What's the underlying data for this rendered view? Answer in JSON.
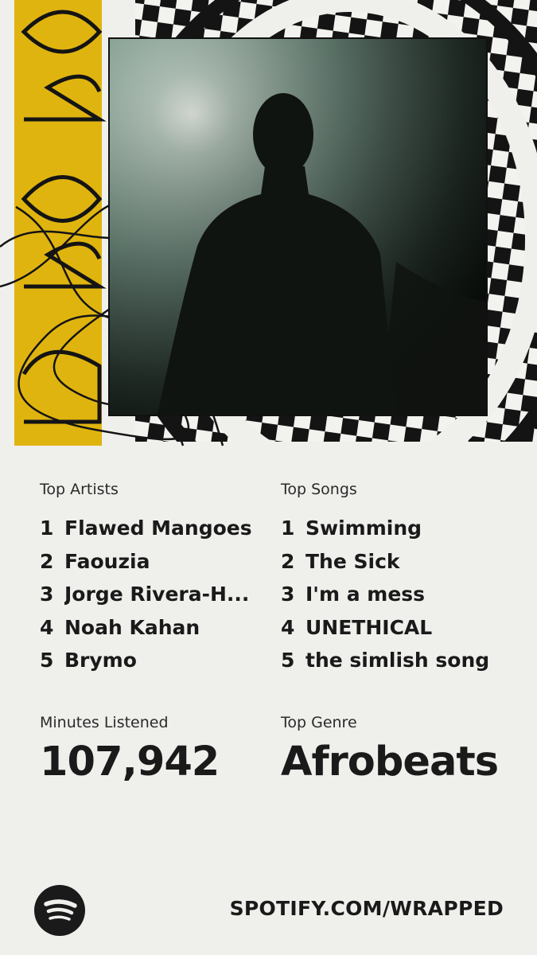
{
  "year_graphic": "2025",
  "top_artists": {
    "label": "Top Artists",
    "items": [
      {
        "rank": "1",
        "name": "Flawed Mangoes"
      },
      {
        "rank": "2",
        "name": "Faouzia"
      },
      {
        "rank": "3",
        "name": "Jorge Rivera-H..."
      },
      {
        "rank": "4",
        "name": "Noah Kahan"
      },
      {
        "rank": "5",
        "name": "Brymo"
      }
    ]
  },
  "top_songs": {
    "label": "Top Songs",
    "items": [
      {
        "rank": "1",
        "name": "Swimming"
      },
      {
        "rank": "2",
        "name": "The Sick"
      },
      {
        "rank": "3",
        "name": "I'm a mess"
      },
      {
        "rank": "4",
        "name": "UNETHICAL"
      },
      {
        "rank": "5",
        "name": "the simlish song"
      }
    ]
  },
  "minutes": {
    "label": "Minutes Listened",
    "value": "107,942"
  },
  "genre": {
    "label": "Top Genre",
    "value": "Afrobeats"
  },
  "footer": {
    "url": "SPOTIFY.COM/WRAPPED",
    "logo_icon": "spotify-logo-icon"
  },
  "colors": {
    "background": "#EFEFEC",
    "accent_yellow": "#E0B40F",
    "text": "#1A1A1A"
  }
}
